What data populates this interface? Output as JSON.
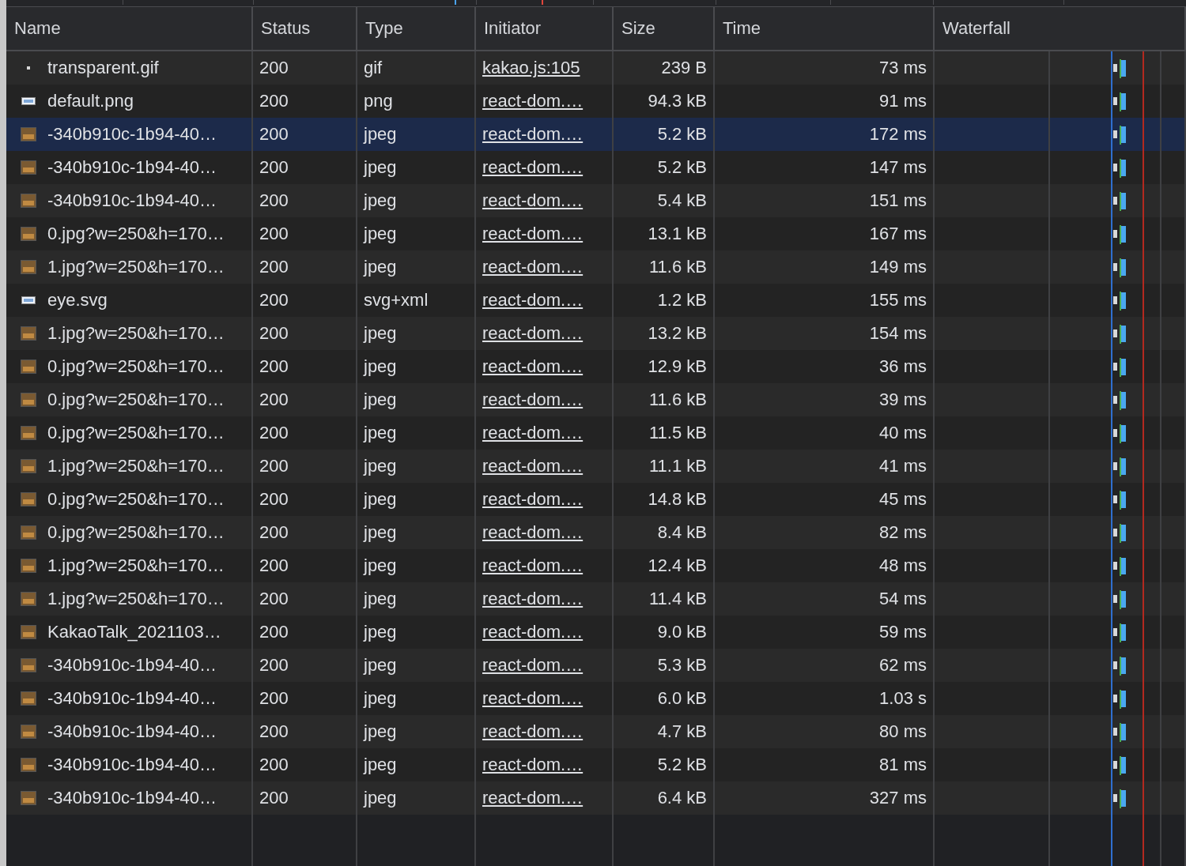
{
  "columns": [
    "Name",
    "Status",
    "Type",
    "Initiator",
    "Size",
    "Time",
    "Waterfall"
  ],
  "rows": [
    {
      "kind": "dot",
      "name": "transparent.gif",
      "status": "200",
      "type": "gif",
      "initiator": "kakao.js:105",
      "size": "239 B",
      "time": "73 ms",
      "selected": false
    },
    {
      "kind": "bar",
      "name": "default.png",
      "status": "200",
      "type": "png",
      "initiator": "react-dom.…",
      "size": "94.3 kB",
      "time": "91 ms",
      "selected": false
    },
    {
      "kind": "image",
      "name": "-340b910c-1b94-40…",
      "status": "200",
      "type": "jpeg",
      "initiator": "react-dom.…",
      "size": "5.2 kB",
      "time": "172 ms",
      "selected": true
    },
    {
      "kind": "image",
      "name": "-340b910c-1b94-40…",
      "status": "200",
      "type": "jpeg",
      "initiator": "react-dom.…",
      "size": "5.2 kB",
      "time": "147 ms",
      "selected": false
    },
    {
      "kind": "image",
      "name": "-340b910c-1b94-40…",
      "status": "200",
      "type": "jpeg",
      "initiator": "react-dom.…",
      "size": "5.4 kB",
      "time": "151 ms",
      "selected": false
    },
    {
      "kind": "image",
      "name": "0.jpg?w=250&h=170…",
      "status": "200",
      "type": "jpeg",
      "initiator": "react-dom.…",
      "size": "13.1 kB",
      "time": "167 ms",
      "selected": false
    },
    {
      "kind": "image",
      "name": "1.jpg?w=250&h=170…",
      "status": "200",
      "type": "jpeg",
      "initiator": "react-dom.…",
      "size": "11.6 kB",
      "time": "149 ms",
      "selected": false
    },
    {
      "kind": "bar",
      "name": "eye.svg",
      "status": "200",
      "type": "svg+xml",
      "initiator": "react-dom.…",
      "size": "1.2 kB",
      "time": "155 ms",
      "selected": false
    },
    {
      "kind": "image",
      "name": "1.jpg?w=250&h=170…",
      "status": "200",
      "type": "jpeg",
      "initiator": "react-dom.…",
      "size": "13.2 kB",
      "time": "154 ms",
      "selected": false
    },
    {
      "kind": "image",
      "name": "0.jpg?w=250&h=170…",
      "status": "200",
      "type": "jpeg",
      "initiator": "react-dom.…",
      "size": "12.9 kB",
      "time": "36 ms",
      "selected": false
    },
    {
      "kind": "image",
      "name": "0.jpg?w=250&h=170…",
      "status": "200",
      "type": "jpeg",
      "initiator": "react-dom.…",
      "size": "11.6 kB",
      "time": "39 ms",
      "selected": false
    },
    {
      "kind": "image",
      "name": "0.jpg?w=250&h=170…",
      "status": "200",
      "type": "jpeg",
      "initiator": "react-dom.…",
      "size": "11.5 kB",
      "time": "40 ms",
      "selected": false
    },
    {
      "kind": "image",
      "name": "1.jpg?w=250&h=170…",
      "status": "200",
      "type": "jpeg",
      "initiator": "react-dom.…",
      "size": "11.1 kB",
      "time": "41 ms",
      "selected": false
    },
    {
      "kind": "image",
      "name": "0.jpg?w=250&h=170…",
      "status": "200",
      "type": "jpeg",
      "initiator": "react-dom.…",
      "size": "14.8 kB",
      "time": "45 ms",
      "selected": false
    },
    {
      "kind": "image",
      "name": "0.jpg?w=250&h=170…",
      "status": "200",
      "type": "jpeg",
      "initiator": "react-dom.…",
      "size": "8.4 kB",
      "time": "82 ms",
      "selected": false
    },
    {
      "kind": "image",
      "name": "1.jpg?w=250&h=170…",
      "status": "200",
      "type": "jpeg",
      "initiator": "react-dom.…",
      "size": "12.4 kB",
      "time": "48 ms",
      "selected": false
    },
    {
      "kind": "image",
      "name": "1.jpg?w=250&h=170…",
      "status": "200",
      "type": "jpeg",
      "initiator": "react-dom.…",
      "size": "11.4 kB",
      "time": "54 ms",
      "selected": false
    },
    {
      "kind": "image",
      "name": "KakaoTalk_2021103…",
      "status": "200",
      "type": "jpeg",
      "initiator": "react-dom.…",
      "size": "9.0 kB",
      "time": "59 ms",
      "selected": false
    },
    {
      "kind": "image",
      "name": "-340b910c-1b94-40…",
      "status": "200",
      "type": "jpeg",
      "initiator": "react-dom.…",
      "size": "5.3 kB",
      "time": "62 ms",
      "selected": false
    },
    {
      "kind": "image",
      "name": "-340b910c-1b94-40…",
      "status": "200",
      "type": "jpeg",
      "initiator": "react-dom.…",
      "size": "6.0 kB",
      "time": "1.03 s",
      "selected": false
    },
    {
      "kind": "image",
      "name": "-340b910c-1b94-40…",
      "status": "200",
      "type": "jpeg",
      "initiator": "react-dom.…",
      "size": "4.7 kB",
      "time": "80 ms",
      "selected": false
    },
    {
      "kind": "image",
      "name": "-340b910c-1b94-40…",
      "status": "200",
      "type": "jpeg",
      "initiator": "react-dom.…",
      "size": "5.2 kB",
      "time": "81 ms",
      "selected": false
    },
    {
      "kind": "image",
      "name": "-340b910c-1b94-40…",
      "status": "200",
      "type": "jpeg",
      "initiator": "react-dom.…",
      "size": "6.4 kB",
      "time": "327 ms",
      "selected": false
    }
  ]
}
